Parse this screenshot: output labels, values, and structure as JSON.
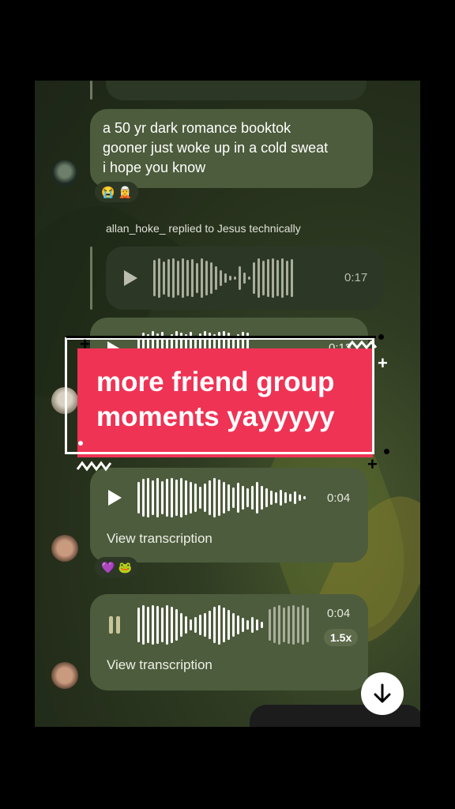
{
  "messages": [
    {
      "id": "m1",
      "text_lines": [
        "a 50 yr dark romance booktok",
        "gooner just woke up in a cold sweat",
        "i hope you know"
      ],
      "reactions": [
        "😭",
        "🧝"
      ]
    },
    {
      "id": "m2",
      "reply_header": "allan_hoke_ replied to Jesus technically",
      "duration": "0:17"
    },
    {
      "id": "m3",
      "duration": "0:13"
    },
    {
      "id": "m4",
      "duration": "0:04",
      "view_transcription": "View transcription",
      "reactions": [
        "💜",
        "🐸"
      ]
    },
    {
      "id": "m5",
      "duration": "0:04",
      "speed": "1.5x",
      "view_transcription": "View transcription"
    }
  ],
  "overlay": {
    "line1": "more friend group",
    "line2": "moments yayyyyy",
    "bg_color": "#ef3355"
  },
  "icons": {
    "scroll_down": "arrow-down-icon",
    "play": "play-icon",
    "pause": "pause-icon"
  }
}
